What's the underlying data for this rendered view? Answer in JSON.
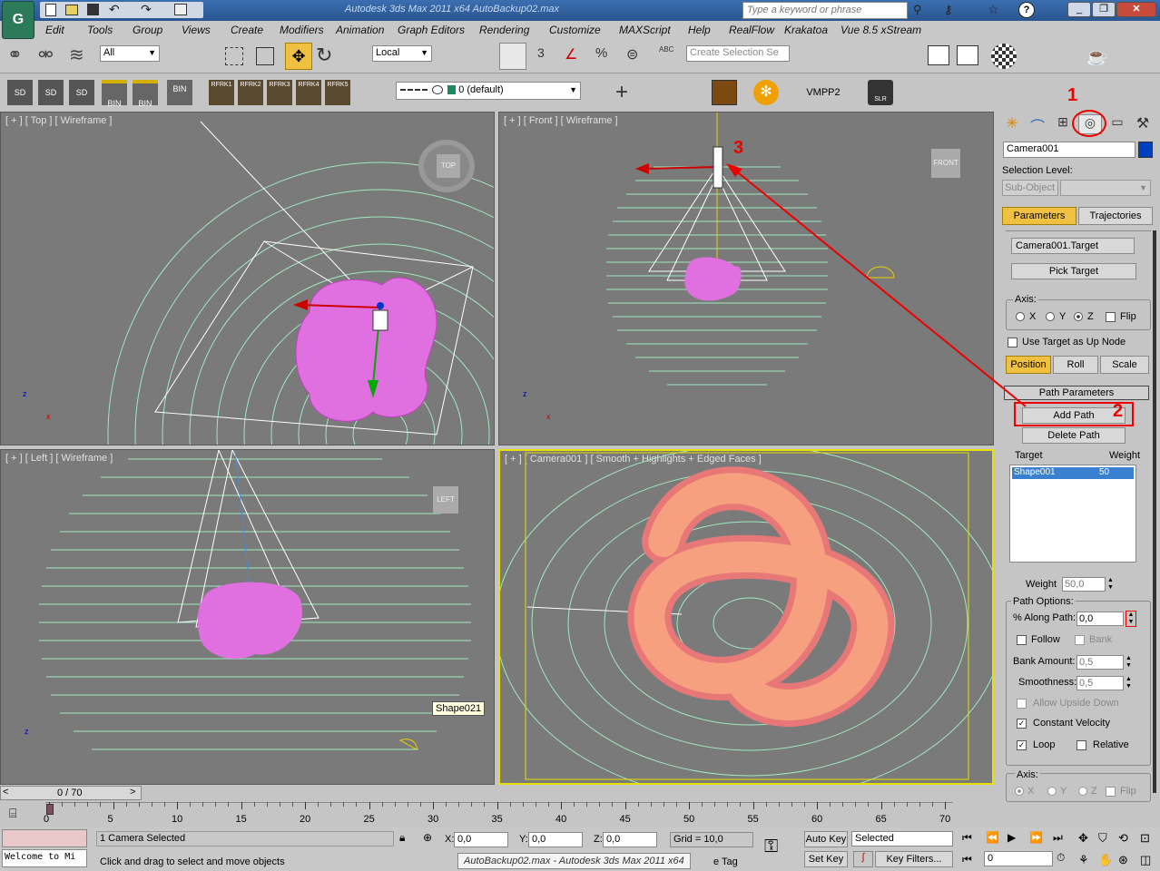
{
  "window": {
    "title": "Autodesk 3ds Max  2011 x64      AutoBackup02.max",
    "search_placeholder": "Type a keyword or phrase"
  },
  "menu": [
    "Edit",
    "Tools",
    "Group",
    "Views",
    "Create",
    "Modifiers",
    "Animation",
    "Graph Editors",
    "Rendering",
    "Customize",
    "MAXScript",
    "Help",
    "RealFlow",
    "Krakatoa",
    "Vue 8.5 xStream"
  ],
  "toolbar": {
    "selection_filter": "All",
    "coord_system": "Local",
    "selection_set_placeholder": "Create Selection Se",
    "layer": "0 (default)",
    "vmpp_label": "VMPP2",
    "sd_labels": [
      "SD",
      "SD",
      "SD"
    ],
    "bin_labels": [
      "BIN",
      "BIN",
      "BIN"
    ],
    "rfrk_labels": [
      "RFRK1",
      "RFRK2",
      "RFRK3",
      "RFRK4",
      "RFRK5"
    ],
    "snap_value": "3",
    "angle_label": "%",
    "abc_label": "ABC",
    "slr_label": "SLR"
  },
  "viewports": {
    "top": {
      "label": "[ + ] [ Top ] [ Wireframe ]",
      "cube": "TOP"
    },
    "front": {
      "label": "[ + ] [ Front ] [ Wireframe ]",
      "cube": "FRONT"
    },
    "left": {
      "label": "[ + ] [ Left ] [ Wireframe ]",
      "cube": "LEFT",
      "tooltip": "Shape021"
    },
    "camera": {
      "label": "[ + ] [ Camera001 ] [ Smooth + Highlights + Edged Faces ]"
    },
    "axis_x": "x",
    "axis_z": "z"
  },
  "annotations": {
    "n1": "1",
    "n2": "2",
    "n3": "3"
  },
  "panel": {
    "object_name": "Camera001",
    "selection_level": "Selection Level:",
    "sub_object": "Sub-Object",
    "tab_parameters": "Parameters",
    "tab_trajectories": "Trajectories",
    "target_name": "Camera001.Target",
    "pick_target": "Pick Target",
    "axis_label": "Axis:",
    "axis_x": "X",
    "axis_y": "Y",
    "axis_z": "Z",
    "flip": "Flip",
    "use_target_up": "Use Target as Up Node",
    "position": "Position",
    "roll": "Roll",
    "scale": "Scale",
    "path_params": "Path Parameters",
    "add_path": "Add Path",
    "delete_path": "Delete Path",
    "col_target": "Target",
    "col_weight": "Weight",
    "list_target": "Shape001",
    "list_weight": "50",
    "weight_label": "Weight",
    "weight_value": "50,0",
    "path_options": "Path Options:",
    "along_path_label": "% Along Path:",
    "along_path_value": "0,0",
    "follow": "Follow",
    "bank": "Bank",
    "bank_amount_label": "Bank Amount:",
    "bank_amount_value": "0,5",
    "smoothness_label": "Smoothness:",
    "smoothness_value": "0,5",
    "allow_upside_down": "Allow Upside Down",
    "constant_velocity": "Constant Velocity",
    "loop": "Loop",
    "relative": "Relative",
    "axis2_label": "Axis:",
    "axis2_x": "X",
    "axis2_y": "Y",
    "axis2_z": "Z",
    "flip2": "Flip"
  },
  "timeline": {
    "frame": "0 / 70",
    "ticks": [
      "0",
      "5",
      "10",
      "15",
      "20",
      "25",
      "30",
      "35",
      "40",
      "45",
      "50",
      "55",
      "60",
      "65",
      "70"
    ]
  },
  "status": {
    "selected": "1 Camera Selected",
    "prompt": "Click and drag to select and move objects",
    "x_label": "X:",
    "x": "0,0",
    "y_label": "Y:",
    "y": "0,0",
    "z_label": "Z:",
    "z": "0,0",
    "grid": "Grid = 10,0",
    "auto_key": "Auto Key",
    "set_key": "Set Key",
    "key_mode": "Selected",
    "key_filters": "Key Filters...",
    "frame_field": "0",
    "welcome": "Welcome to Mi",
    "tooltip": "AutoBackup02.max - Autodesk 3ds Max  2011 x64",
    "add_tag": "e Tag"
  }
}
